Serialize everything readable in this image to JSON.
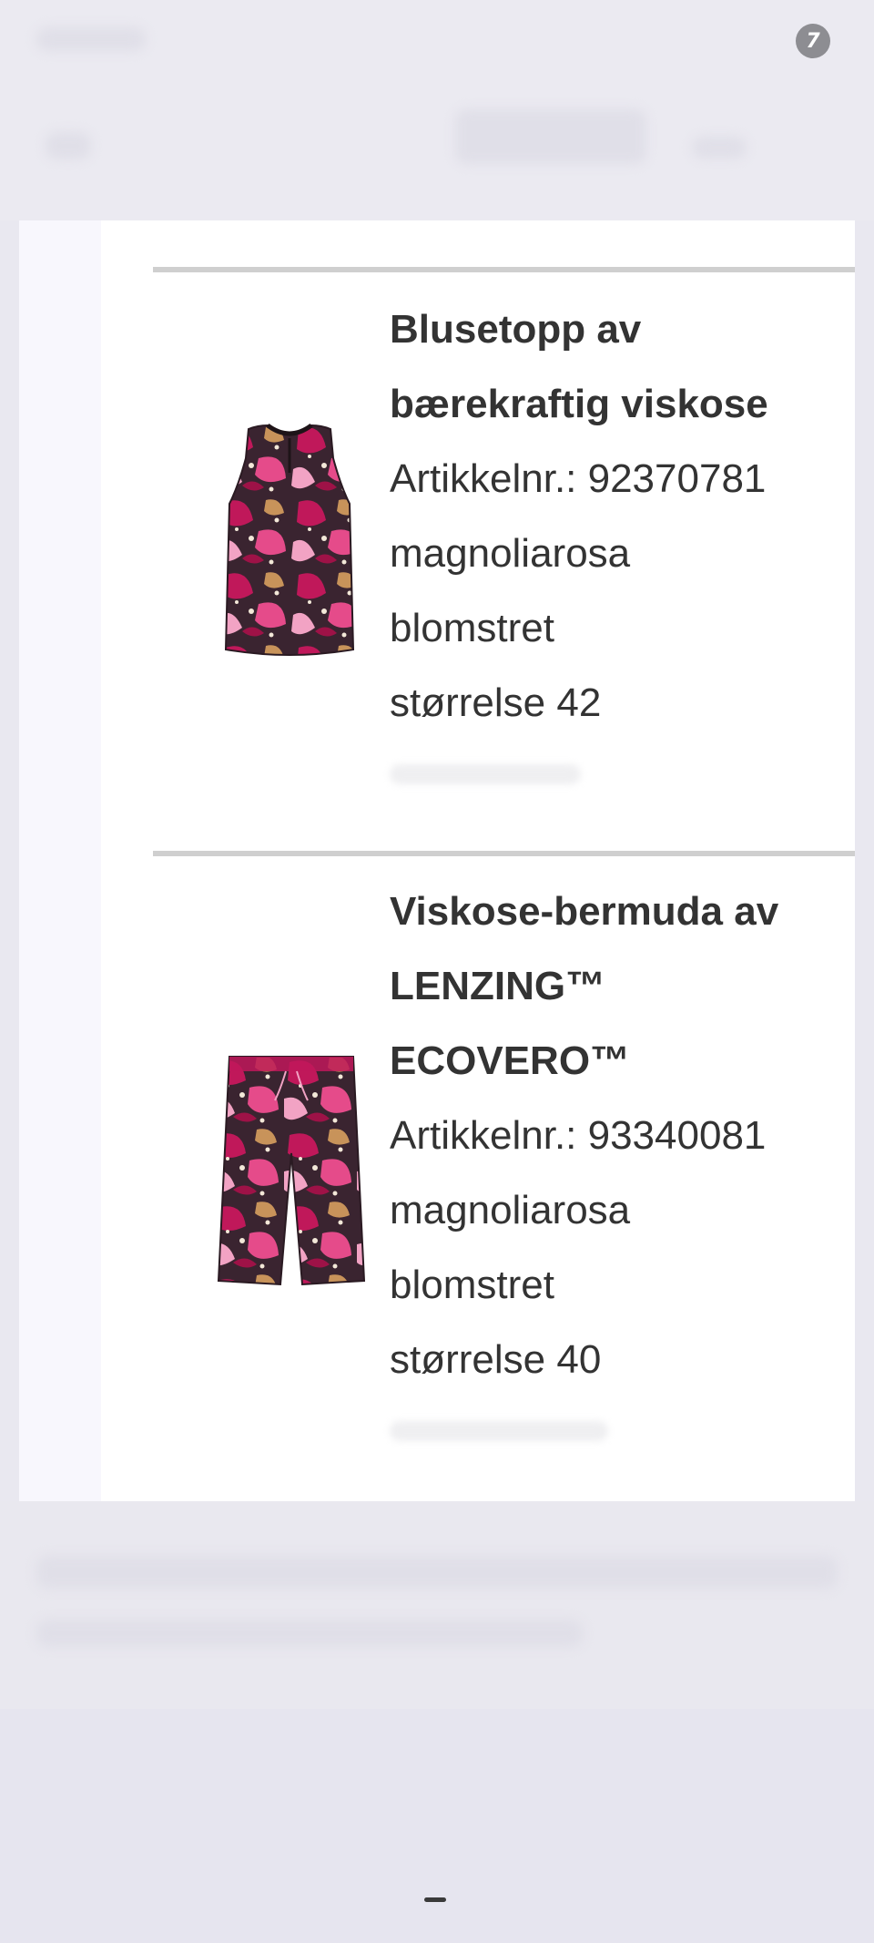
{
  "header": {
    "avatar_icon": "user-avatar-icon",
    "avatar_letter": "7"
  },
  "order": {
    "products": [
      {
        "name_line1": "Blusetopp av",
        "name_line2": "bærekraftig viskose",
        "name_line3": "",
        "article_number": "Artikkelnr.: 92370781",
        "color": "magnoliarosa",
        "pattern": "blomstret",
        "size": "størrelse 42",
        "image_icon": "sleeveless-top-image"
      },
      {
        "name_line1": "Viskose-bermuda av",
        "name_line2": "LENZING™",
        "name_line3": "ECOVERO™",
        "article_number": "Artikkelnr.: 93340081",
        "color": "magnoliarosa",
        "pattern": "blomstret",
        "size": "størrelse 40",
        "image_icon": "bermuda-shorts-image"
      }
    ]
  },
  "colors": {
    "background": "#e9e8f0",
    "card": "#ffffff",
    "divider": "#cfcfcf",
    "text": "#333333",
    "print_magenta": "#c0185a",
    "print_dark": "#3a2430",
    "print_pink": "#f2a3c4"
  }
}
